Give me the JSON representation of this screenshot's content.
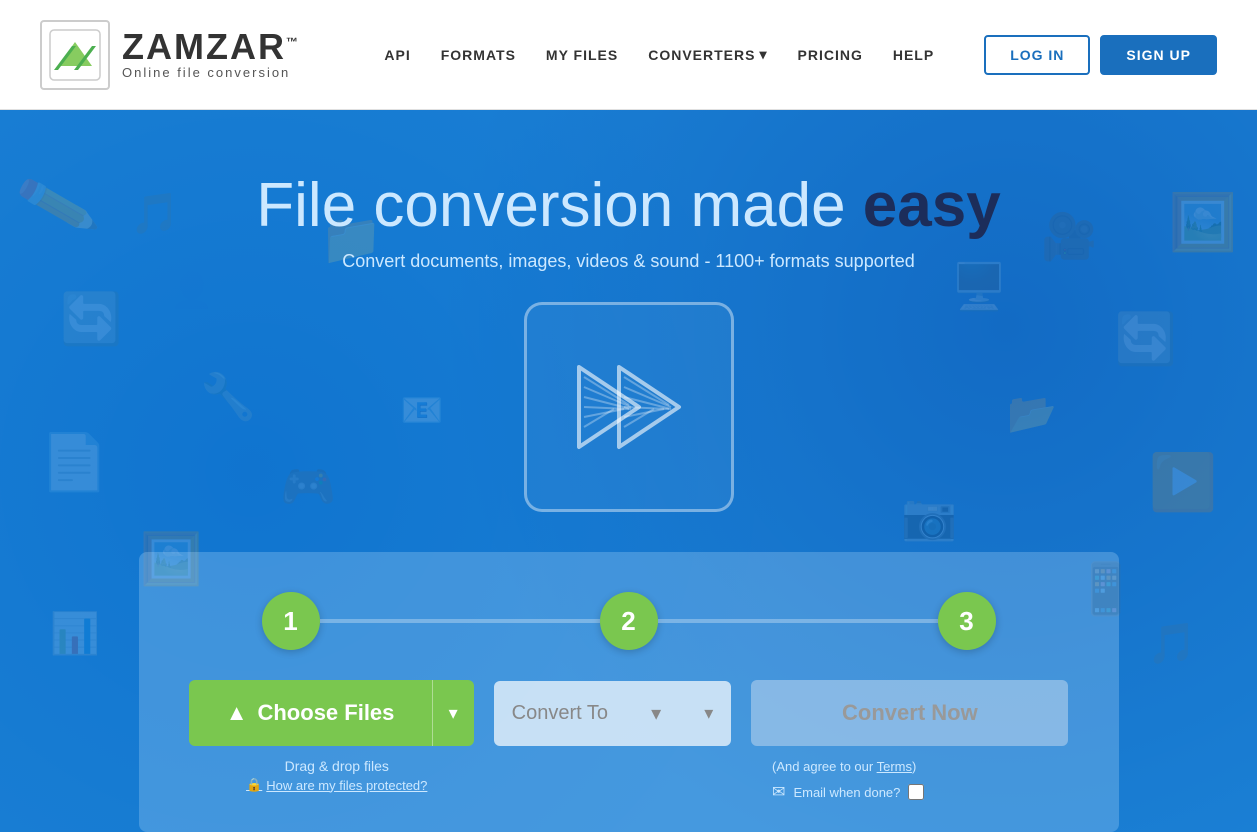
{
  "header": {
    "logo_name": "ZAMZAR",
    "logo_tm": "™",
    "logo_tagline": "Online  file  conversion",
    "nav": {
      "api": "API",
      "formats": "FORMATS",
      "my_files": "MY FILES",
      "converters": "CONVERTERS",
      "converters_arrow": "▾",
      "pricing": "PRICING",
      "help": "HELP"
    },
    "login_label": "LOG IN",
    "signup_label": "SIGN UP"
  },
  "hero": {
    "title_light": "File conversion made ",
    "title_bold": "easy",
    "subtitle": "Convert documents, images, videos & sound - 1100+ formats supported"
  },
  "steps": {
    "step1": "1",
    "step2": "2",
    "step3": "3"
  },
  "actions": {
    "choose_files_label": "Choose Files",
    "choose_files_dropdown_icon": "▾",
    "convert_to_placeholder": "Convert To",
    "convert_to_arrow": "▾",
    "convert_now_label": "Convert Now"
  },
  "below_actions": {
    "drag_drop": "Drag & drop files",
    "security_icon": "🔒",
    "security_link": "How are my files protected?",
    "agree_text": "(And agree to our ",
    "terms_link": "Terms",
    "agree_close": ")",
    "email_icon": "✉",
    "email_label": "Email when done?"
  },
  "colors": {
    "hero_bg": "#1a7fd4",
    "green": "#7ac74f",
    "step_circle": "#7ac74f",
    "title_light": "#cce8ff",
    "title_bold": "#1c2d5a"
  }
}
